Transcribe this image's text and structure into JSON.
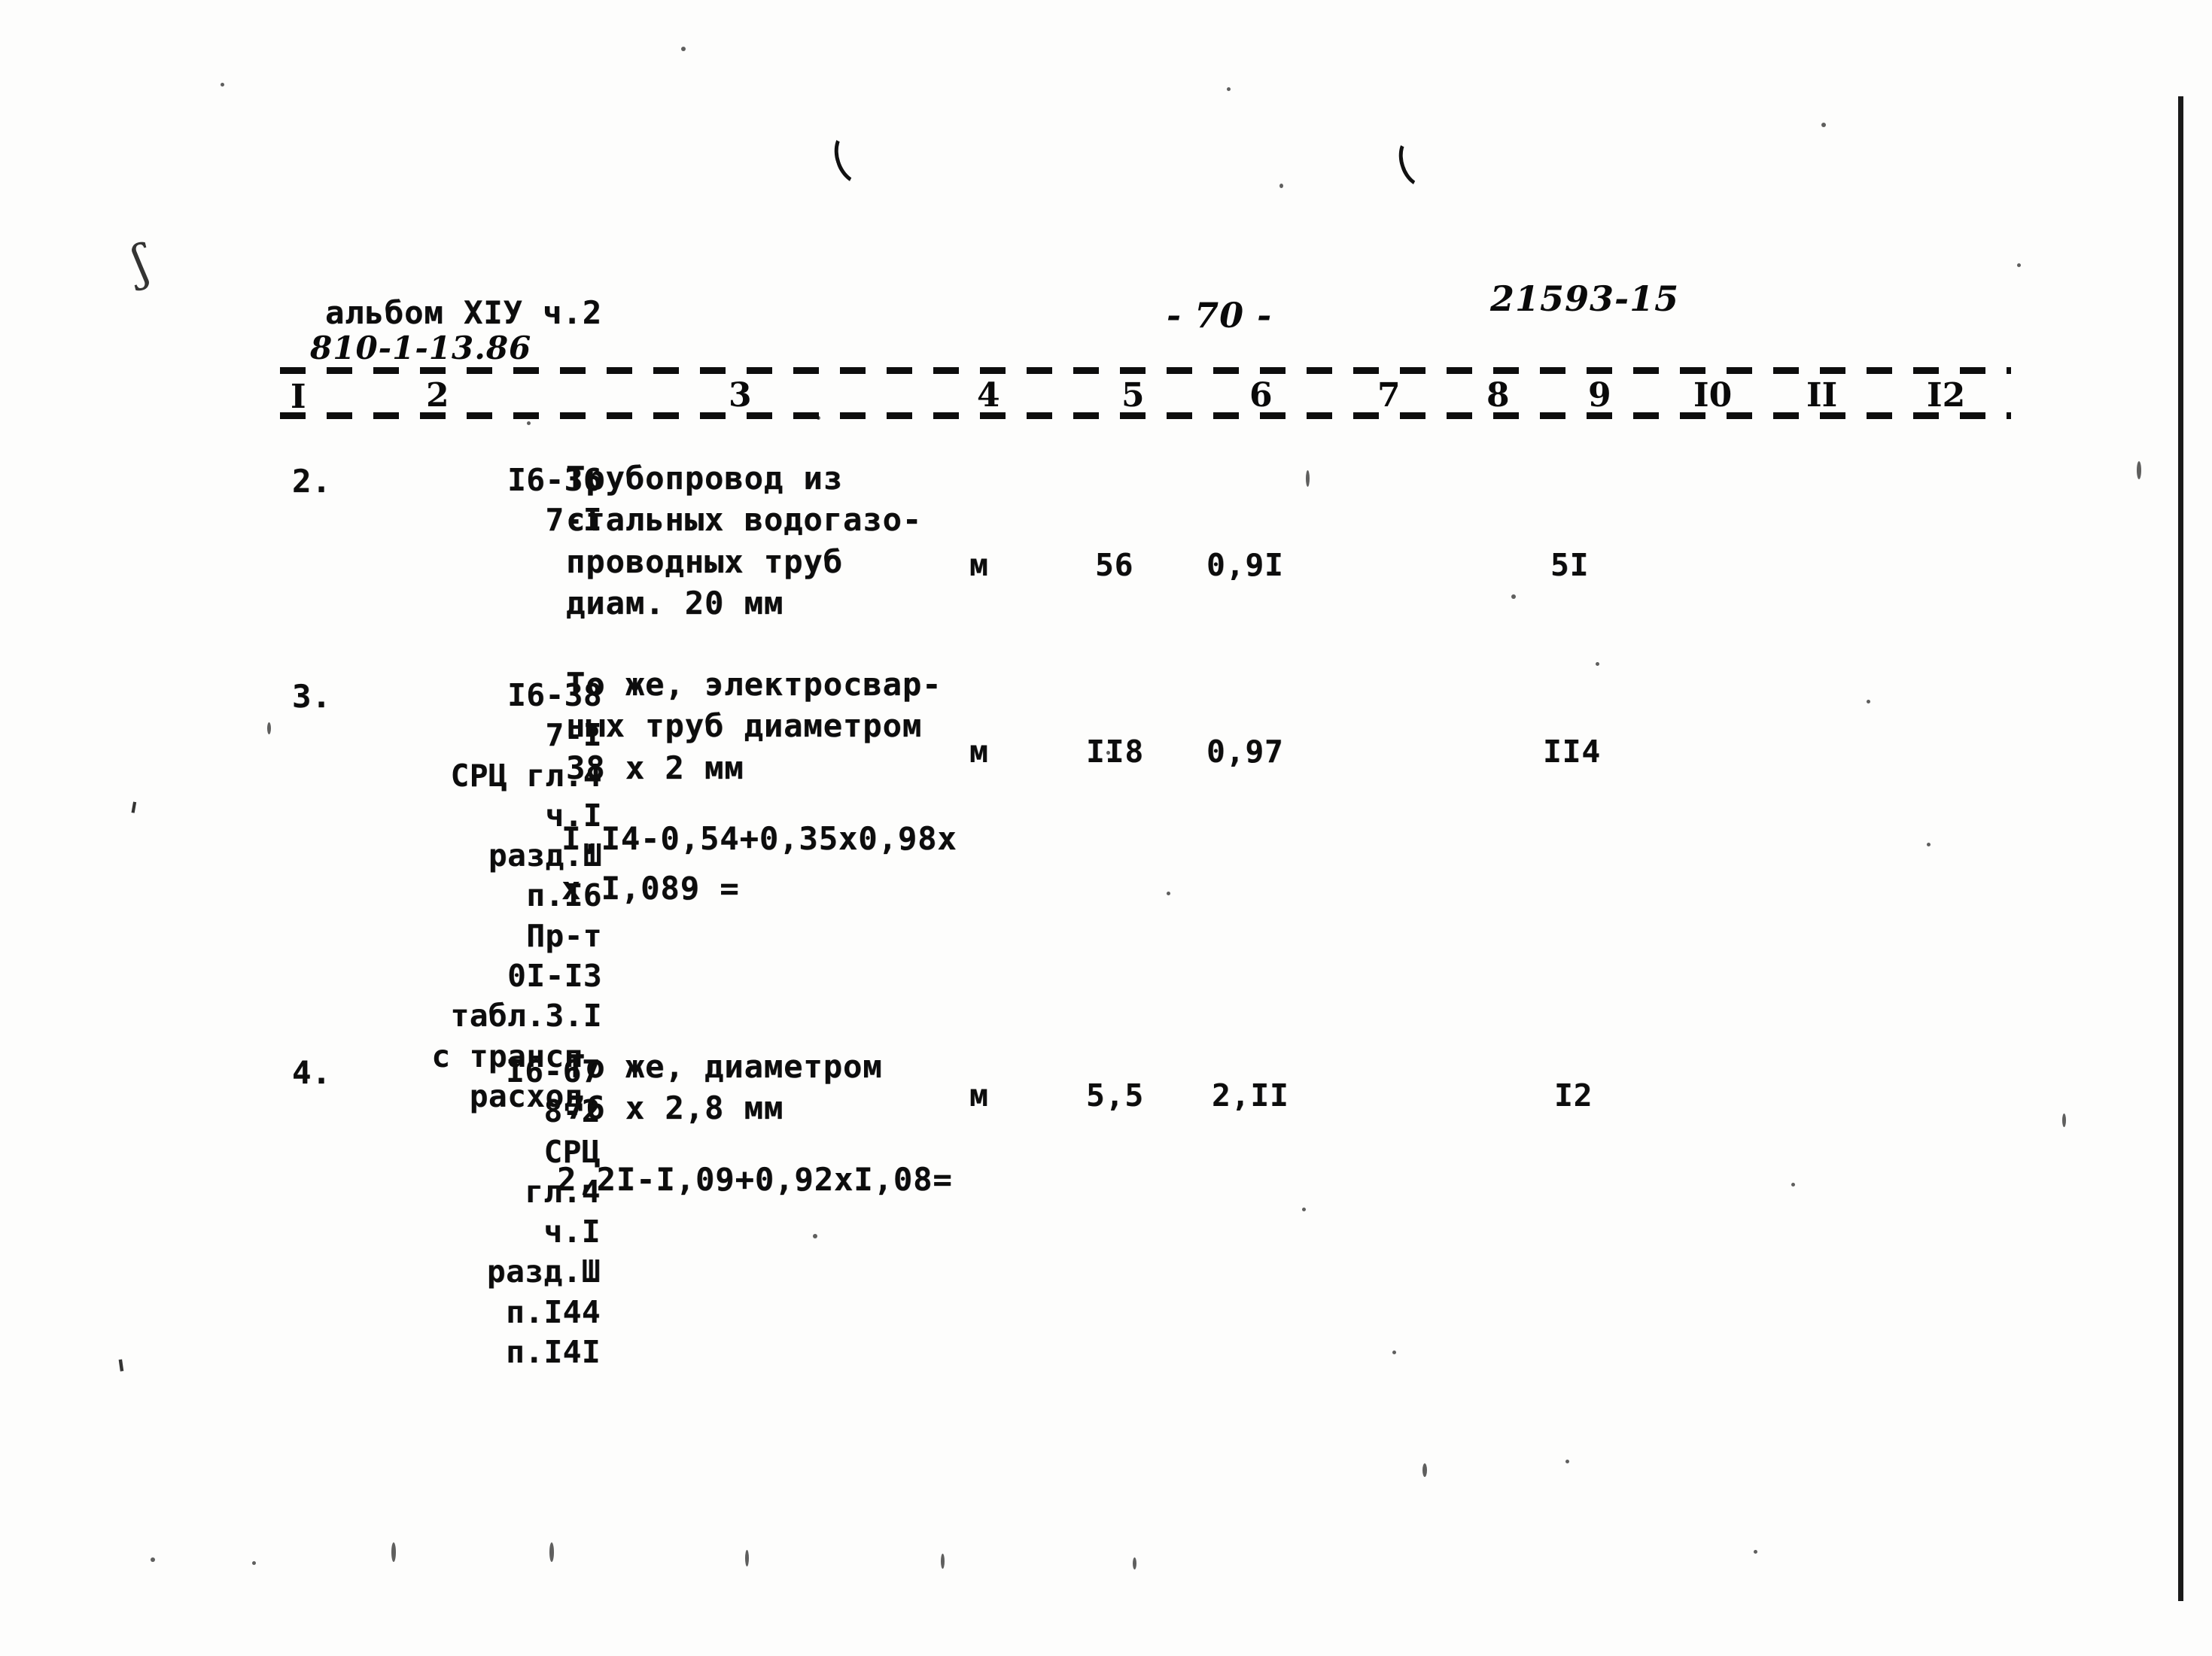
{
  "document": {
    "album_line": "альбом ХIУ ч.2",
    "album_code": "810-1-13.86",
    "page_marker": "- 70 -",
    "doc_number": "21593-15"
  },
  "table": {
    "column_numbers": [
      "I",
      "2",
      "3",
      "4",
      "5",
      "6",
      "7",
      "8",
      "9",
      "I0",
      "II",
      "I2"
    ],
    "rows": [
      {
        "no": "2.",
        "codes": "I6-36\n7-I",
        "description": "Трубопровод из\nстальных водогазо-\nпроводных труб\nдиам. 20 мм",
        "unit": "м",
        "qty": "56",
        "price": "0,9I",
        "total": "5I",
        "formula": ""
      },
      {
        "no": "3.",
        "codes": "I6-38\n7-I\nСРЦ гл.4\nч.I\nразд.Ш\nп.I6\nПр-т\n0I-I3\nтабл.3.I\nс трансп.\nрасход.",
        "description": "То же, электросвар-\nных труб диаметром\n38 х 2 мм",
        "unit": "м",
        "qty": "II8",
        "price": "0,97",
        "total": "II4",
        "formula": "I,I4-0,54+0,35х0,98х\nх I,089 ="
      },
      {
        "no": "4.",
        "codes": "I6-67\n8-2\nСРЦ\nгл.4\nч.I\nразд.Ш\nп.I44\nп.I4I",
        "description": "То же, диаметром\n76 х 2,8 мм",
        "unit": "м",
        "qty": "5,5",
        "price": "2,II",
        "total": "I2",
        "formula": "2,2I-I,09+0,92хI,08="
      }
    ]
  }
}
